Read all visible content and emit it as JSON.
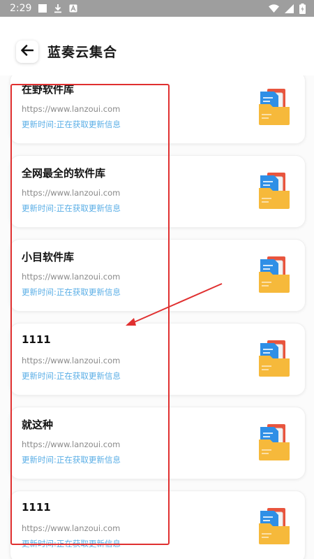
{
  "status_bar": {
    "time": "2:29",
    "left_icons": [
      "stop-icon",
      "download-icon",
      "a-box-icon"
    ],
    "right_icons": [
      "wifi-icon",
      "cell-signal-icon",
      "battery-icon"
    ]
  },
  "header": {
    "title": "蓝奏云集合",
    "back_icon": "arrow-left-icon"
  },
  "cards": [
    {
      "title": "在野软件库",
      "url": "https://www.lanzoui.com",
      "status": "更新时间:正在获取更新信息"
    },
    {
      "title": "全网最全的软件库",
      "url": "https://www.lanzoui.com",
      "status": "更新时间:正在获取更新信息"
    },
    {
      "title": "小目软件库",
      "url": "https://www.lanzoui.com",
      "status": "更新时间:正在获取更新信息"
    },
    {
      "title": "1111",
      "url": "https://www.lanzoui.com",
      "status": "更新时间:正在获取更新信息"
    },
    {
      "title": "就这种",
      "url": "https://www.lanzoui.com",
      "status": "更新时间:正在获取更新信息"
    },
    {
      "title": "1111",
      "url": "https://www.lanzoui.com",
      "status": "更新时间:正在获取更新信息"
    }
  ],
  "card_icon": "folder-document-icon",
  "colors": {
    "status_bar": "#9e9e9e",
    "status_text": "#5aaee6",
    "annotation": "#e03030",
    "folder": "#f6b93b",
    "doc_blue": "#2f8fe6",
    "doc_red": "#e8553e"
  }
}
